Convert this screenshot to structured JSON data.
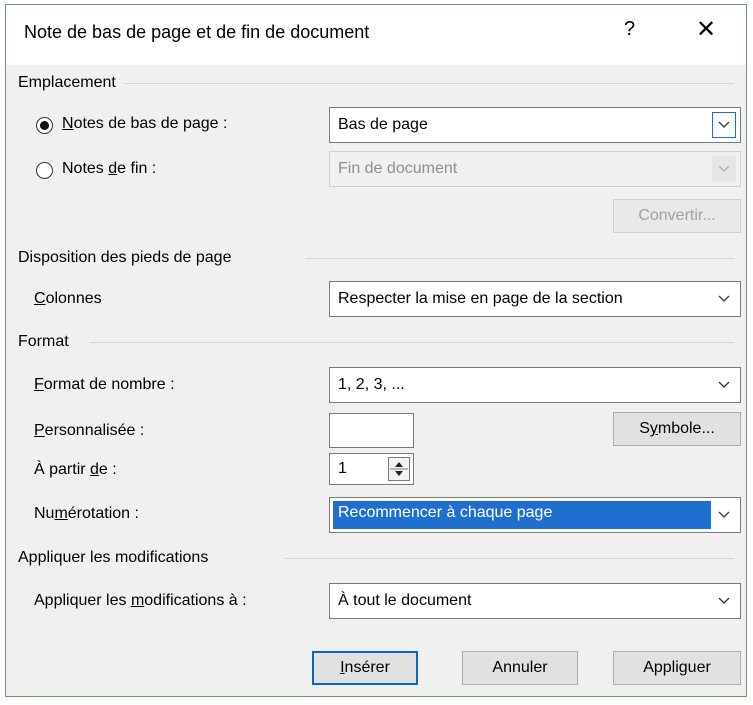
{
  "dialog": {
    "title": "Note de bas de page et de fin de document",
    "help_glyph": "?",
    "close_glyph": "✕"
  },
  "emplacement": {
    "heading": "Emplacement",
    "footnotes_label_pre": "",
    "footnotes_label_u": "N",
    "footnotes_label_post": "otes de bas de page :",
    "footnotes_value": "Bas de page",
    "endnotes_label_pre": "Notes ",
    "endnotes_label_u": "d",
    "endnotes_label_post": "e fin :",
    "endnotes_value": "Fin de document",
    "selected": "footnotes",
    "convert_label": "Convertir..."
  },
  "disposition": {
    "heading": "Disposition des pieds de page",
    "columns_label_u": "C",
    "columns_label_post": "olonnes",
    "columns_value": "Respecter la mise en page de la section"
  },
  "format": {
    "heading": "Format",
    "number_format_label_u": "F",
    "number_format_label_post": "ormat de nombre :",
    "number_format_value": "1, 2, 3, ...",
    "custom_label_u": "P",
    "custom_label_post": "ersonnalisée :",
    "custom_value": "",
    "symbol_label_pre": "S",
    "symbol_label_u": "y",
    "symbol_label_post": "mbole...",
    "start_label_pre": "À partir ",
    "start_label_u": "d",
    "start_label_post": "e :",
    "start_value": "1",
    "numbering_label_pre": "Nu",
    "numbering_label_u": "m",
    "numbering_label_post": "érotation :",
    "numbering_value": "Recommencer à chaque page"
  },
  "apply": {
    "heading": "Appliquer les modifications",
    "apply_label_pre": "Appliquer les ",
    "apply_label_u": "m",
    "apply_label_post": "odifications à :",
    "apply_value": "À tout le document"
  },
  "buttons": {
    "insert_u": "I",
    "insert_post": "nsérer",
    "cancel": "Annuler",
    "apply_pre": "Appli",
    "apply_u": "g",
    "apply_post": "uer"
  },
  "colors": {
    "accent": "#0a64c8",
    "selection": "#1f6fd1",
    "dialog_bg": "#f0f0f0",
    "frame": "#6e9b6e"
  }
}
